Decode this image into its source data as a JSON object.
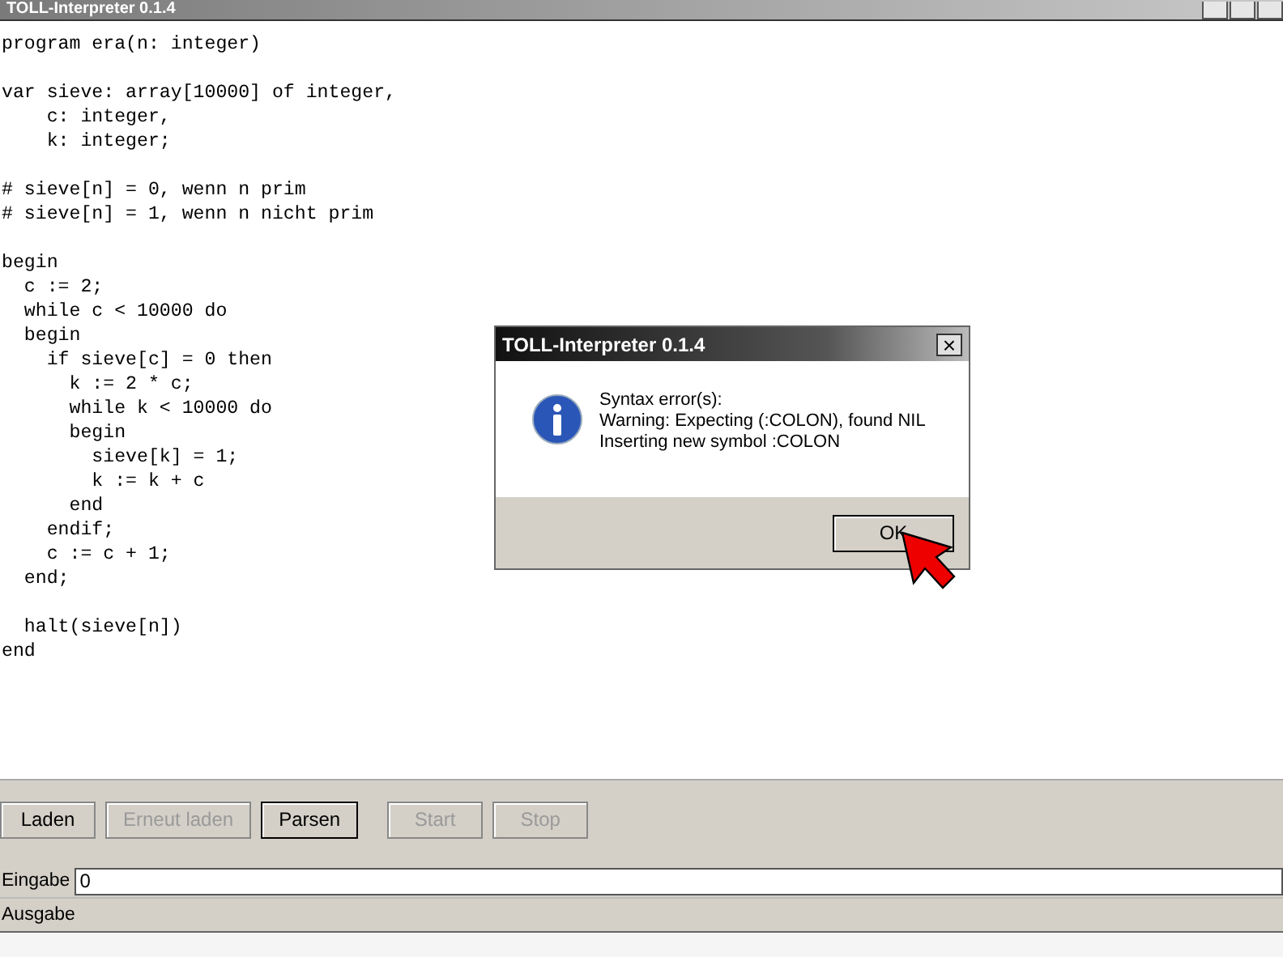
{
  "window": {
    "title": "TOLL-Interpreter 0.1.4"
  },
  "editor": {
    "lines": [
      {
        "text": "program era(n: integer)",
        "blank_before": false
      },
      {
        "text": "var sieve: array[10000] of integer,",
        "blank_before": true
      },
      {
        "text": "    c: integer,",
        "blank_before": false
      },
      {
        "text": "    k: integer;",
        "blank_before": false
      },
      {
        "text": "# sieve[n] = 0, wenn n prim",
        "blank_before": true
      },
      {
        "text": "# sieve[n] = 1, wenn n nicht prim",
        "blank_before": false
      },
      {
        "text": "begin",
        "blank_before": true
      },
      {
        "text": "  c := 2;",
        "blank_before": false
      },
      {
        "text": "  while c < 10000 do",
        "blank_before": false
      },
      {
        "text": "  begin",
        "blank_before": false
      },
      {
        "text": "    if sieve[c] = 0 then",
        "blank_before": false
      },
      {
        "text": "      k := 2 * c;",
        "blank_before": false
      },
      {
        "text": "      while k < 10000 do",
        "blank_before": false
      },
      {
        "text": "      begin",
        "blank_before": false
      },
      {
        "text": "        sieve[k] = 1;",
        "blank_before": false
      },
      {
        "text": "        k := k + c",
        "blank_before": false
      },
      {
        "text": "      end",
        "blank_before": false
      },
      {
        "text": "    endif;",
        "blank_before": false
      },
      {
        "text": "    c := c + 1;",
        "blank_before": false
      },
      {
        "text": "  end;",
        "blank_before": false
      },
      {
        "text": "  halt(sieve[n])",
        "blank_before": true
      },
      {
        "text": "end",
        "blank_before": false
      }
    ]
  },
  "buttons": [
    {
      "label": "Laden",
      "disabled": false,
      "focused": false
    },
    {
      "label": "Erneut laden",
      "disabled": true,
      "focused": false
    },
    {
      "label": "Parsen",
      "disabled": false,
      "focused": true
    },
    {
      "label": "Start",
      "disabled": true,
      "focused": false
    },
    {
      "label": "Stop",
      "disabled": true,
      "focused": false
    }
  ],
  "input": {
    "label": "Eingabe",
    "value": "0"
  },
  "output": {
    "label": "Ausgabe"
  },
  "dialog": {
    "title": "TOLL-Interpreter 0.1.4",
    "close": "×",
    "message": [
      "Syntax error(s):",
      "Warning: Expecting (:COLON), found NIL",
      "Inserting new symbol :COLON"
    ],
    "button": "OK"
  }
}
